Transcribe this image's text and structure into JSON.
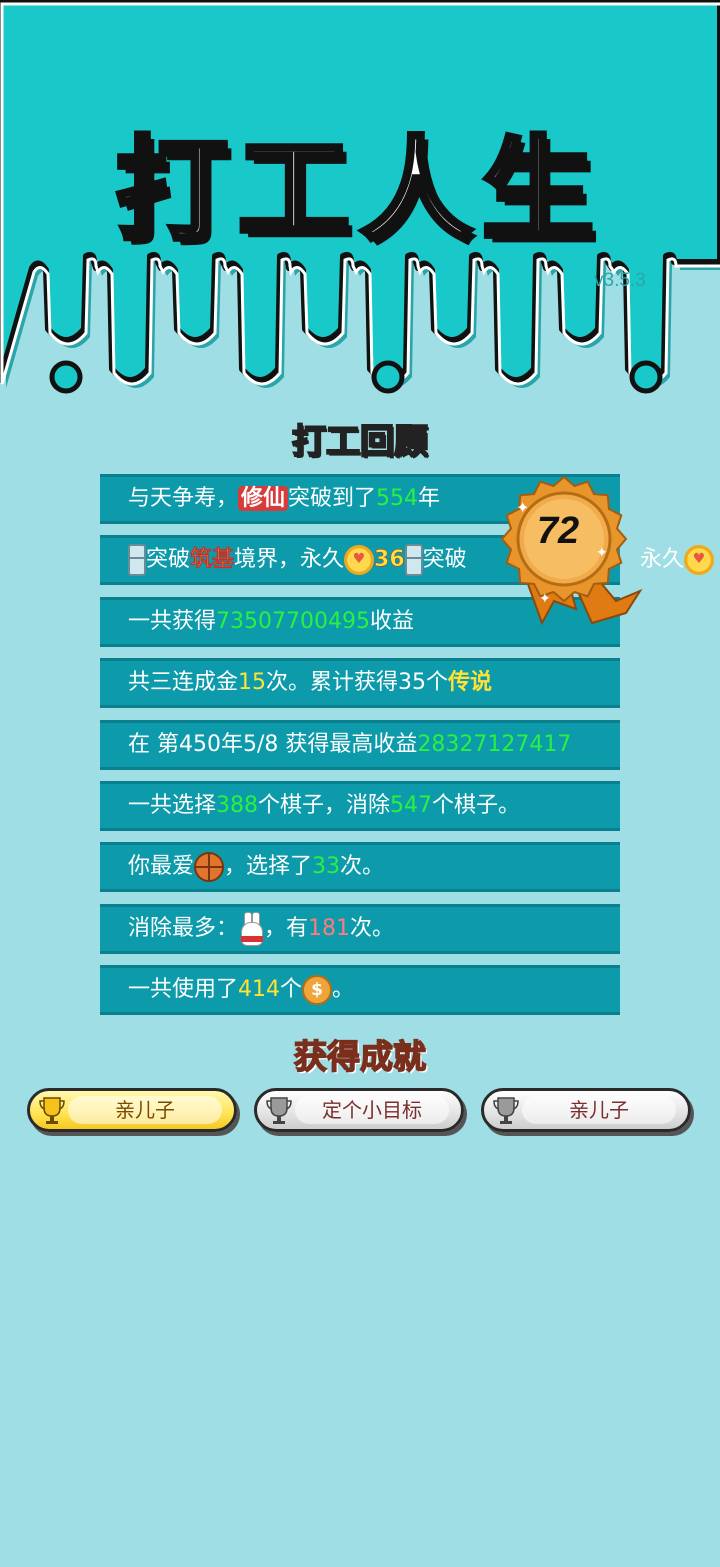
{
  "header": {
    "title": "打工人生",
    "version": "v3.5.3",
    "colors": {
      "top": "#19c8c9",
      "stroke": "#111111"
    }
  },
  "review": {
    "title": "打工回顾",
    "rows": [
      {
        "prefix": "与天争寿，",
        "badge": "修仙",
        "mid": "突破到了",
        "value": "554",
        "suffix": "年"
      },
      {
        "prefix": "突破",
        "badge": "筑基",
        "mid": "境界，永久",
        "value": "36",
        "suffix": "突破",
        "tail": "永久"
      },
      {
        "prefix": "一共获得",
        "value": "73507700495",
        "suffix": "收益"
      },
      {
        "prefix": "共三连成金",
        "value": "15",
        "mid": "次。累计获得35个",
        "badge": "传说"
      },
      {
        "prefix": "在 第450年5/8 获得最高收益",
        "value": "28327127417"
      },
      {
        "prefix": "一共选择",
        "value": "388",
        "mid": "个棋子，消除",
        "value2": "547",
        "suffix": "个棋子。"
      },
      {
        "prefix": "你最爱",
        "icon": "basketball-icon",
        "mid": "，选择了",
        "value": "33",
        "suffix": "次。"
      },
      {
        "prefix": "消除最多：",
        "icon": "rabbit-icon",
        "mid": "，有",
        "value": "181",
        "suffix": "次。"
      },
      {
        "prefix": "一共使用了",
        "value": "414",
        "mid": "个",
        "icon": "coin-icon",
        "suffix": "。"
      }
    ]
  },
  "medal": {
    "number": "72"
  },
  "achievements": {
    "title": "获得成就",
    "items": [
      {
        "label": "亲儿子",
        "state": "gold",
        "icon": "trophy-icon"
      },
      {
        "label": "定个小目标",
        "state": "gray",
        "icon": "trophy-icon"
      },
      {
        "label": "亲儿子",
        "state": "gray",
        "icon": "trophy-icon"
      }
    ]
  },
  "coin_symbol": "$"
}
